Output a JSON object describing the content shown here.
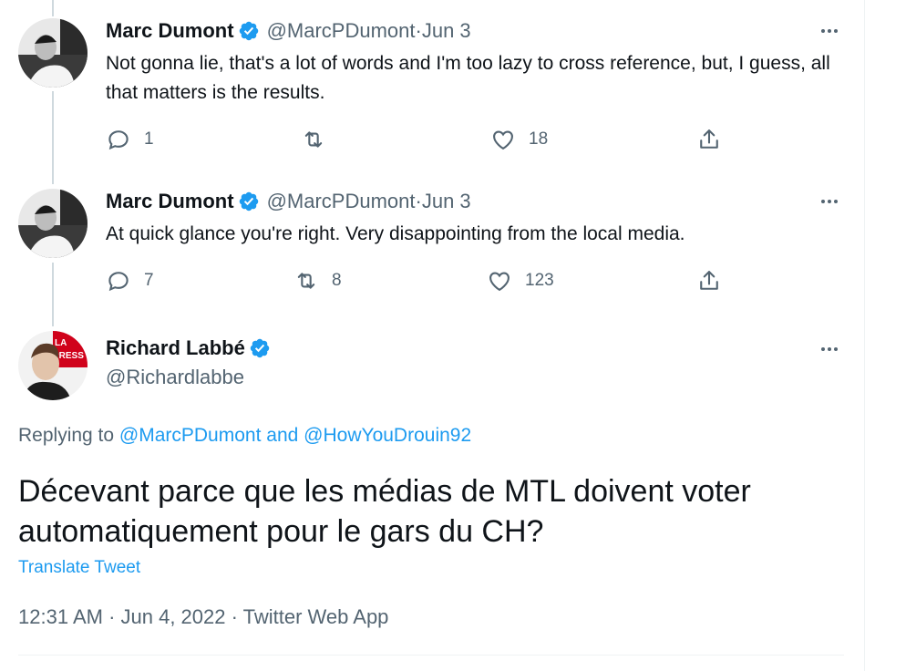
{
  "colors": {
    "accent": "#1d9bf0",
    "secondary_text": "#536471",
    "primary_text": "#0f1419"
  },
  "tweets": [
    {
      "name": "Marc Dumont",
      "handle": "@MarcPDumont",
      "date": "Jun 3",
      "text": "Not gonna lie, that's a lot of words and I'm too lazy to cross reference, but, I guess, all that matters is the results.",
      "replies": "1",
      "retweets": "",
      "likes": "18"
    },
    {
      "name": "Marc Dumont",
      "handle": "@MarcPDumont",
      "date": "Jun 3",
      "text": "At quick glance you're right. Very disappointing from the local media.",
      "replies": "7",
      "retweets": "8",
      "likes": "123"
    }
  ],
  "focus": {
    "name": "Richard Labbé",
    "handle": "@Richardlabbe",
    "replying_prefix": "Replying to ",
    "replying_user1": "@MarcPDumont",
    "replying_and": " and ",
    "replying_user2": "@HowYouDrouin92",
    "text": "Décevant parce que les médias de MTL doivent voter automatiquement pour le gars du CH?",
    "translate": "Translate Tweet",
    "timestamp": "12:31 AM · Jun 4, 2022 · Twitter Web App",
    "avatar_badge": "LA PRESSE"
  },
  "separator": " · ",
  "icons": [
    "reply-icon",
    "retweet-icon",
    "like-icon",
    "share-icon",
    "verified-badge-icon",
    "more-icon"
  ]
}
